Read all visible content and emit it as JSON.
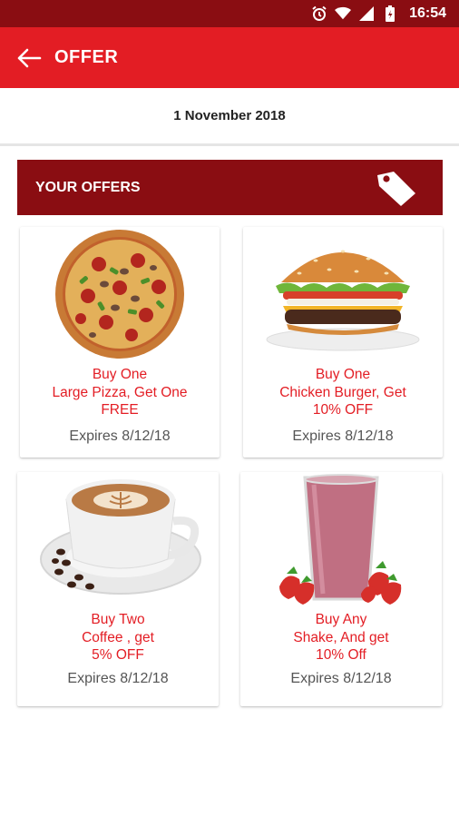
{
  "status_bar": {
    "time": "16:54",
    "icons": [
      "alarm-icon",
      "wifi-icon",
      "signal-icon",
      "battery-icon"
    ]
  },
  "app_bar": {
    "title": "OFFER",
    "back_icon": "arrow-left-icon",
    "color": "#e31d24"
  },
  "date": "1 November 2018",
  "offers_header": {
    "title": "YOUR OFFERS",
    "icon": "tag-icon",
    "color": "#8a0d12"
  },
  "offers": [
    {
      "image": "pizza",
      "line1": "Buy One",
      "line2": "Large Pizza, Get One",
      "line3": "FREE",
      "expires": "Expires 8/12/18"
    },
    {
      "image": "burger",
      "line1": "Buy One",
      "line2": "Chicken Burger, Get",
      "line3": "10% OFF",
      "expires": "Expires 8/12/18"
    },
    {
      "image": "coffee",
      "line1": "Buy Two",
      "line2": "Coffee , get",
      "line3": "5% OFF",
      "expires": "Expires 8/12/18"
    },
    {
      "image": "shake",
      "line1": "Buy Any",
      "line2": "Shake, And get",
      "line3": "10% Off",
      "expires": "Expires 8/12/18"
    }
  ]
}
